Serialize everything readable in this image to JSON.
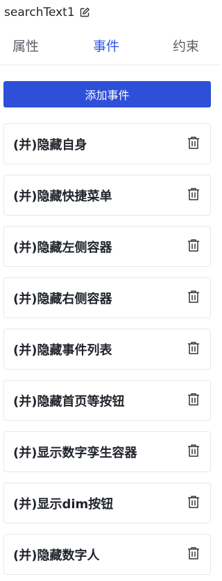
{
  "header": {
    "title": "searchText1",
    "edit_icon": "edit-icon"
  },
  "tabs": [
    {
      "label": "属性",
      "active": false
    },
    {
      "label": "事件",
      "active": true
    },
    {
      "label": "约束",
      "active": false
    }
  ],
  "colors": {
    "accent": "#2f54eb",
    "button": "#2e4fd8"
  },
  "add_event_label": "添加事件",
  "events": [
    {
      "label": "(并)隐藏自身",
      "icon": "trash-icon"
    },
    {
      "label": "(并)隐藏快捷菜单",
      "icon": "trash-icon"
    },
    {
      "label": "(并)隐藏左侧容器",
      "icon": "trash-icon"
    },
    {
      "label": "(并)隐藏右侧容器",
      "icon": "trash-icon"
    },
    {
      "label": "(并)隐藏事件列表",
      "icon": "trash-icon"
    },
    {
      "label": "(并)隐藏首页等按钮",
      "icon": "trash-icon"
    },
    {
      "label": "(并)显示数字孪生容器",
      "icon": "trash-icon"
    },
    {
      "label": "(并)显示dim按钮",
      "icon": "trash-icon"
    },
    {
      "label": "(并)隐藏数字人",
      "icon": "trash-icon"
    }
  ]
}
